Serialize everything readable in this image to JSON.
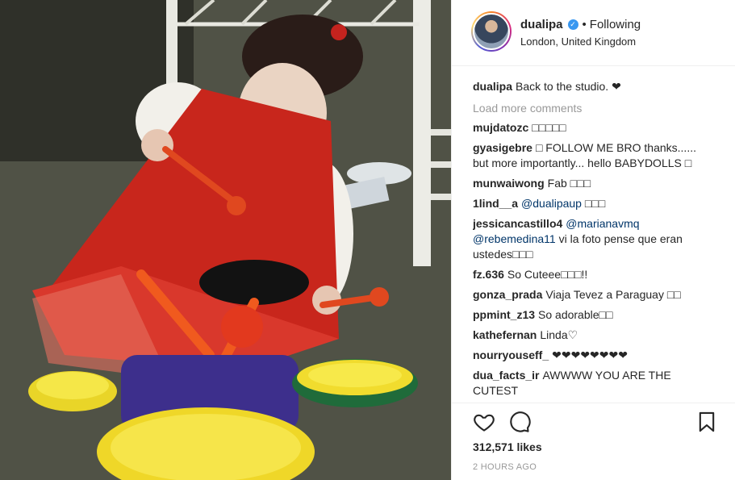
{
  "photo": {
    "alt": "",
    "icon": "post-photo"
  },
  "header": {
    "username": "dualipa",
    "verified_icon": "verified-badge-icon",
    "separator": "•",
    "follow_status": "Following",
    "location": "London, United Kingdom"
  },
  "caption": {
    "user": "dualipa",
    "text": "Back to the studio. ❤"
  },
  "load_more": "Load more comments",
  "comments": [
    {
      "user": "mujdatozc",
      "text": "□□□□□"
    },
    {
      "user": "gyasigebre",
      "text": "□ FOLLOW ME BRO thanks...... but more importantly... hello BABYDOLLS □"
    },
    {
      "user": "munwaiwong",
      "text": "Fab □□□"
    },
    {
      "user": "1lind__a",
      "mention": "@dualipaup",
      "text": " □□□"
    },
    {
      "user": "jessicancastillo4",
      "mention": "@marianavmq",
      "mention2": "@rebemedina11",
      "text": " vi la foto pense que eran ustedes□□□"
    },
    {
      "user": "fz.636",
      "text": "So Cuteee□□□!!"
    },
    {
      "user": "gonza_prada",
      "text": "Viaja Tevez a Paraguay □□"
    },
    {
      "user": "ppmint_z13",
      "text": "So adorable□□"
    },
    {
      "user": "kathefernan",
      "text": "Linda♡"
    },
    {
      "user": "nourryouseff_",
      "text": "❤❤❤❤❤❤❤❤"
    },
    {
      "user": "dua_facts_ir",
      "text": "AWWWW YOU ARE THE CUTEST"
    }
  ],
  "actions": {
    "like_icon": "heart-icon",
    "comment_icon": "comment-icon",
    "save_icon": "bookmark-icon"
  },
  "likes": "312,571 likes",
  "timestamp": "2 HOURS AGO",
  "colors": {
    "text": "#262626",
    "muted": "#999999",
    "link": "#003569",
    "verified": "#3897f0",
    "divider": "#efefef"
  }
}
